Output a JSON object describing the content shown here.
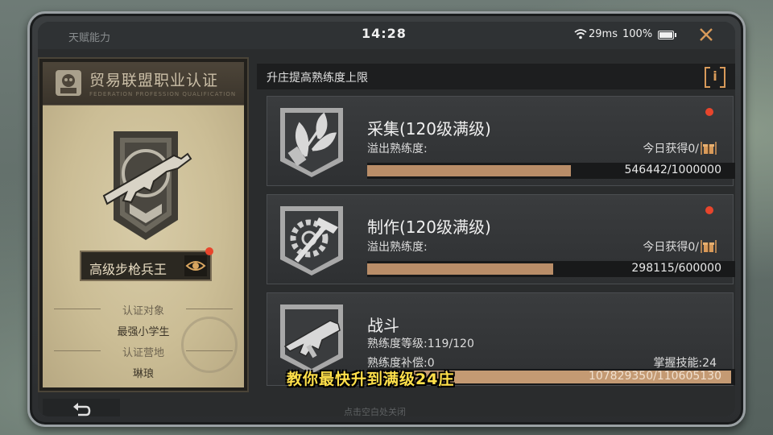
{
  "status_bar": {
    "app_title": "天赋能力",
    "time": "14:28",
    "ping": "29ms",
    "battery": "100%"
  },
  "certificate": {
    "title": "贸易联盟职业认证",
    "subtitle": "FEDERATION PROFESSION QUALIFICATION",
    "rank": "高级步枪兵王",
    "target_label": "认证对象",
    "target_value": "最强小学生",
    "camp_label": "认证营地",
    "camp_value": "琳琅"
  },
  "panel": {
    "header": "升庄提高熟练度上限",
    "info_label": "i"
  },
  "skills": [
    {
      "name": "采集(120级满级)",
      "line1": "溢出熟练度:",
      "right1": "今日获得0/",
      "progress_text": "546442/1000000",
      "progress": 0.546
    },
    {
      "name": "制作(120级满级)",
      "line1": "溢出熟练度:",
      "right1": "今日获得0/",
      "progress_text": "298115/600000",
      "progress": 0.497
    },
    {
      "name": "战斗",
      "line1": "熟练度等级:119/120",
      "line2": "熟练度补偿:0",
      "right1": "掌握技能:24",
      "progress_text": "107829350/110605130",
      "progress": 0.975
    }
  ],
  "bottom": {
    "hint": "点击空白处关闭"
  },
  "caption": "教你最快升到满级24庄",
  "colors": {
    "accent": "#d89a5a",
    "progress": "#b98d68",
    "alert": "#e8452c",
    "caption": "#ffe04a"
  }
}
